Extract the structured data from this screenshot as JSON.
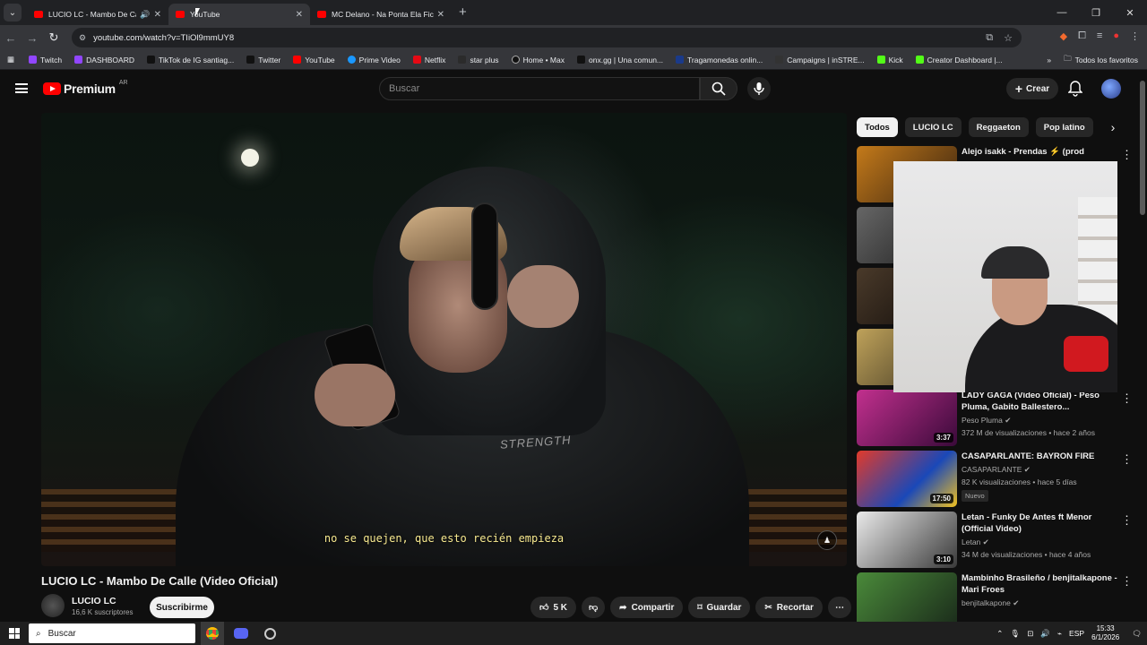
{
  "browser": {
    "tabs": [
      {
        "title": "LUCIO LC - Mambo De Calle",
        "active": false,
        "audio": true
      },
      {
        "title": "YouTube",
        "active": true,
        "audio": false
      },
      {
        "title": "MC Delano - Na Ponta Ela Fica",
        "active": false,
        "audio": false
      }
    ],
    "url": "youtube.com/watch?v=TIiOl9mmUY8",
    "bookmarks": [
      {
        "label": "Twitch",
        "color": "#9146ff"
      },
      {
        "label": "DASHBOARD",
        "color": "#9146ff"
      },
      {
        "label": "TikTok de IG santiag...",
        "color": "#111111"
      },
      {
        "label": "Twitter",
        "color": "#111111"
      },
      {
        "label": "YouTube",
        "color": "#ff0000"
      },
      {
        "label": "Prime Video",
        "color": "#1a98ff"
      },
      {
        "label": "Netflix",
        "color": "#e50914"
      },
      {
        "label": "star plus",
        "color": "#2b2b2b"
      },
      {
        "label": "Home • Max",
        "color": "#111111"
      },
      {
        "label": "onx.gg | Una comun...",
        "color": "#111111"
      },
      {
        "label": "Tragamonedas onlin...",
        "color": "#1a3a8a"
      },
      {
        "label": "Campaigns | inSTRE...",
        "color": "#333333"
      },
      {
        "label": "Kick",
        "color": "#53fc18"
      },
      {
        "label": "Creator Dashboard |...",
        "color": "#53fc18"
      }
    ],
    "all_bookmarks": "Todos los favoritos"
  },
  "youtube": {
    "logo_text": "Premium",
    "country_code": "AR",
    "search_placeholder": "Buscar",
    "create_label": "Crear",
    "video": {
      "title": "LUCIO LC - Mambo De Calle (Video Oficial)",
      "caption": "no se quejen, que esto recién empieza",
      "channel": "LUCIO LC",
      "subscribers": "16,6 K suscriptores",
      "subscribe_label": "Suscribirme",
      "likes": "5 K",
      "share_label": "Compartir",
      "save_label": "Guardar",
      "clip_label": "Recortar",
      "shirt_text": "STRENGTH"
    },
    "chips": [
      "Todos",
      "LUCIO LC",
      "Reggaeton",
      "Pop latino"
    ],
    "recommendations": [
      {
        "title": "Alejo isakk - Prendas ⚡ (prod",
        "channel": "",
        "stats": "",
        "duration": "",
        "thumb": "#8a5a1c"
      },
      {
        "title": "",
        "channel": "",
        "stats": "",
        "duration": "",
        "thumb": "#3a3a3a"
      },
      {
        "title": "",
        "channel": "",
        "stats": "",
        "duration": "",
        "thumb": "#2a2420"
      },
      {
        "title": "",
        "channel": "",
        "stats": "",
        "duration": "",
        "thumb": "#5a4a2a"
      },
      {
        "title": "LADY GAGA (Video Oficial) - Peso Pluma, Gabito Ballestero...",
        "channel": "Peso Pluma",
        "stats": "372 M de visualizaciones • hace 2 años",
        "duration": "3:37",
        "thumb": "#7a1e6a"
      },
      {
        "title": "CASAPARLANTE: BAYRON FIRE",
        "channel": "CASAPARLANTE",
        "stats": "82 K visualizaciones • hace 5 días",
        "duration": "17:50",
        "thumb": "#2850a8",
        "badge": "Nuevo"
      },
      {
        "title": "Letan - Funky De Antes ft Menor (Official Video)",
        "channel": "Letan",
        "stats": "34 M de visualizaciones • hace 4 años",
        "duration": "3:10",
        "thumb": "#6a6a6a"
      },
      {
        "title": "Mambinho Brasileño / benjitalkapone - Mari Froes",
        "channel": "benjitalkapone",
        "stats": "",
        "duration": "",
        "thumb": "#3a6a3a"
      }
    ]
  },
  "taskbar": {
    "search_label": "Buscar",
    "lang": "ESP",
    "time": "15:33",
    "date": "6/1/2026"
  }
}
